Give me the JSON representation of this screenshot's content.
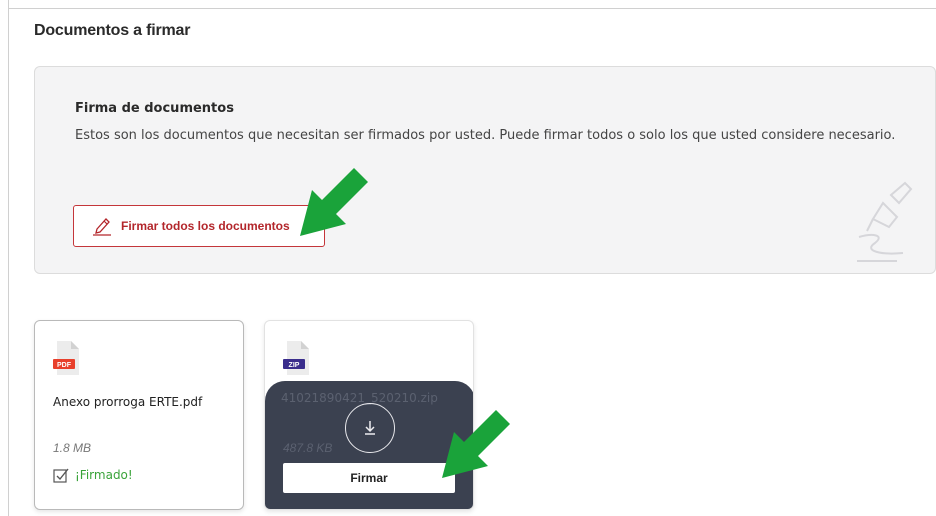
{
  "section": {
    "title": "Documentos a firmar"
  },
  "info": {
    "title": "Firma de documentos",
    "text": "Estos son los documentos que necesitan ser firmados por usted. Puede firmar todos o solo los que usted considere necesario.",
    "sign_all_label": "Firmar todos los documentos"
  },
  "documents": [
    {
      "type_badge": "PDF",
      "name": "Anexo prorroga ERTE.pdf",
      "size": "1.8 MB",
      "status": "¡Firmado!"
    },
    {
      "type_badge": "ZIP",
      "name": "41021890421_520210.zip",
      "size": "487.8 KB",
      "action_label": "Firmar"
    }
  ],
  "colors": {
    "accent": "#b3262b",
    "signed": "#3aa33a",
    "overlay": "#3b4150",
    "arrow": "#1aa33a"
  },
  "icons": [
    "pen-sign-icon",
    "pen-watermark-icon",
    "pdf-file-icon",
    "zip-file-icon",
    "checkbox-icon",
    "download-icon",
    "green-arrow-icon"
  ]
}
